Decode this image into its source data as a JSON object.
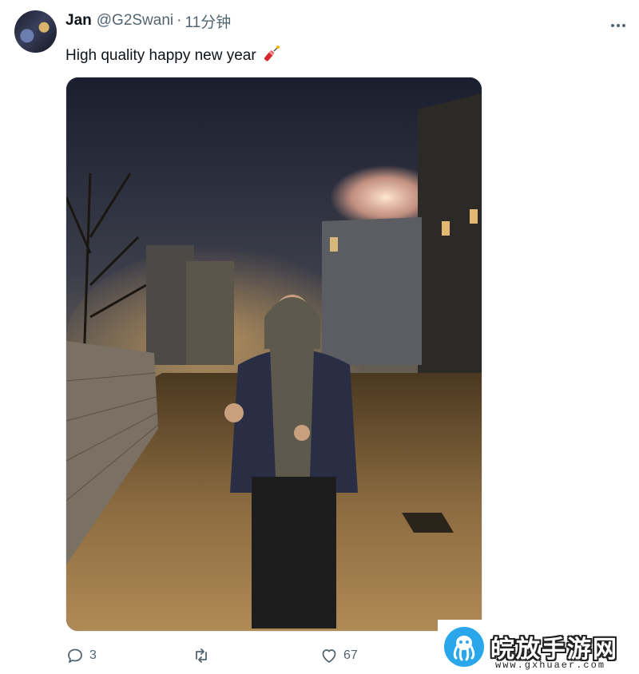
{
  "tweet": {
    "author_name": "Jan",
    "handle": "@G2Swani",
    "separator": "·",
    "time": "11分钟",
    "text": "High quality happy new year",
    "emoji": "firecracker-icon"
  },
  "actions": {
    "reply_count": "3",
    "retweet_count": "",
    "like_count": "67"
  },
  "watermark": {
    "title": "皖放手游网",
    "url": "www.gxhuaer.com"
  },
  "colors": {
    "text_primary": "#0f1419",
    "text_secondary": "#536471",
    "watermark_blue": "#2aa7ea"
  }
}
